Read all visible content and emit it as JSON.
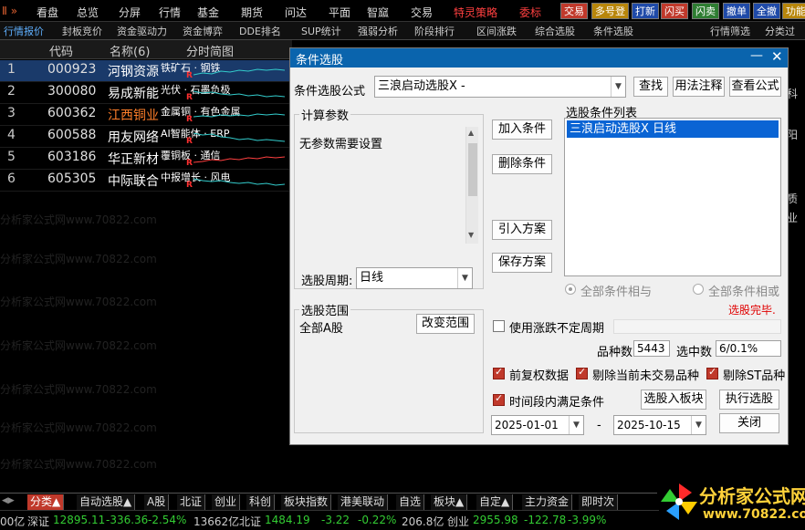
{
  "menubar": {
    "left_marker": "Ⅱ »",
    "items": [
      "看盘",
      "总览",
      "分屏",
      "行情",
      "基金",
      "期货",
      "问达",
      "平面",
      "智窳",
      "交易"
    ],
    "special": "特灵策略",
    "special2": "委标",
    "buttons": [
      "交易",
      "多号登",
      "打新",
      "闪买",
      "闪卖",
      "撤单",
      "全撤",
      "功能"
    ]
  },
  "subtabs": [
    "行情报价",
    "封板竞价",
    "资金驱动力",
    "资金博弈",
    "DDE排名",
    "SUP统计",
    "强弱分析",
    "阶段排行",
    "区间涨跌",
    "综合选股",
    "条件选股",
    "行情筛选",
    "分类过"
  ],
  "table": {
    "headers": [
      "代码",
      "名称(6)",
      "分时简图"
    ],
    "rows": [
      {
        "n": "1",
        "code": "000923",
        "name": "河钢资源",
        "tag": "铁矿石 · 钢铁"
      },
      {
        "n": "2",
        "code": "300080",
        "name": "易成新能",
        "tag": "光伏 · 石墨负极"
      },
      {
        "n": "3",
        "code": "600362",
        "name": "江西铜业",
        "tag": "金属铜 · 有色金属"
      },
      {
        "n": "4",
        "code": "600588",
        "name": "用友网络",
        "tag": "AI智能体 · ERP"
      },
      {
        "n": "5",
        "code": "603186",
        "name": "华正新材",
        "tag": "覆铜板 · 通信"
      },
      {
        "n": "6",
        "code": "605305",
        "name": "中际联合",
        "tag": "中报增长 · 风电"
      }
    ],
    "row_mark": "R",
    "colors": {
      "code": "#e0e0e0",
      "name": "#ffffff",
      "name_highlight": "#ff7f2a",
      "tag": "#ffffff"
    }
  },
  "right_stub": [
    "科",
    "阳",
    "质",
    "业"
  ],
  "watermark": "分析家公式网www.70822.com",
  "dialog": {
    "title": "条件选股",
    "formula_label": "条件选股公式",
    "formula_value": "三浪启动选股X  -",
    "btn_find": "查找",
    "btn_usage": "用法注释",
    "btn_view": "查看公式",
    "calc_group": "计算参数",
    "calc_text": "无参数需要设置",
    "period_label": "选股周期:",
    "period_value": "日线",
    "btn_add": "加入条件",
    "btn_delete": "删除条件",
    "btn_import": "引入方案",
    "btn_save": "保存方案",
    "list_label": "选股条件列表",
    "list_items": [
      "三浪启动选股X  日线"
    ],
    "radio_and": "全部条件相与",
    "radio_or": "全部条件相或",
    "done_text": "选股完毕.",
    "range_group": "选股范围",
    "range_value": "全部A股",
    "btn_change_range": "改变范围",
    "cb_undetermined": "使用涨跌不定周期",
    "count_label": "品种数",
    "count_value": "5443",
    "selected_label": "选中数",
    "selected_value": "6/0.1%",
    "cb_adjust": "前复权数据",
    "cb_no_trade": "剔除当前未交易品种",
    "cb_st": "剔除ST品种",
    "cb_period": "时间段内满足条件",
    "btn_to_block": "选股入板块",
    "btn_execute": "执行选股",
    "date_from": "2025-01-01",
    "date_sep": "-",
    "date_to": "2025-10-15",
    "btn_close": "关闭"
  },
  "bottom_tabs": [
    "分类▲",
    "自动选股▲",
    "A股",
    "北证",
    "创业",
    "科创",
    "板块指数",
    "港美联动",
    "自选",
    "板块▲",
    "自定▲",
    "主力资金",
    "即时次"
  ],
  "statusbar": {
    "prefix": "00亿",
    "sz_label": "深证",
    "sz_value": "12895.11",
    "sz_change": "-336.36",
    "sz_pct": "-2.54%",
    "sz_amount": "13662亿",
    "bz_label": "北证",
    "bz_value": "1484.19",
    "bz_change": "-3.22",
    "bz_pct": "-0.22%",
    "bz_amount": "206.8亿",
    "cy_label": "创业",
    "cy_value": "2955.98",
    "cy_change": "-122.78",
    "cy_pct": "-3.99%"
  },
  "logo": {
    "name": "分析家公式网",
    "url": "www.70822.com"
  }
}
